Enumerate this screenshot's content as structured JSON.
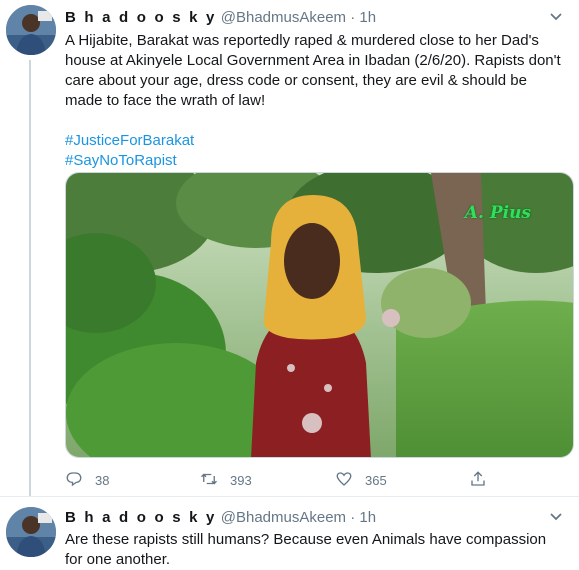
{
  "tweet1": {
    "name": "B h a d o o s k y",
    "handle": "@BhadmusAkeem",
    "separator": "·",
    "time": "1h",
    "text": "A Hijabite, Barakat was reportedly raped & murdered close to her Dad's house at Akinyele Local Government Area in Ibadan (2/6/20). Rapists don't care about your age, dress code or consent, they are evil & should be made to face the wrath of law!",
    "hashtags": [
      "#JusticeForBarakat",
      "#SayNoToRapist"
    ],
    "image_watermark": "A. Pius",
    "replies": "38",
    "retweets": "393",
    "likes": "365"
  },
  "tweet2": {
    "name": "B h a d o o s k y",
    "handle": "@BhadmusAkeem",
    "separator": "·",
    "time": "1h",
    "text": "Are these rapists still humans? Because even Animals have compassion for one another."
  },
  "icons": {
    "reply": "reply-icon",
    "retweet": "retweet-icon",
    "like": "heart-icon",
    "share": "share-icon",
    "more": "chevron-down-icon"
  },
  "colors": {
    "link": "#1b95e0",
    "muted": "#657786",
    "thread_line": "#ccd6dd"
  }
}
